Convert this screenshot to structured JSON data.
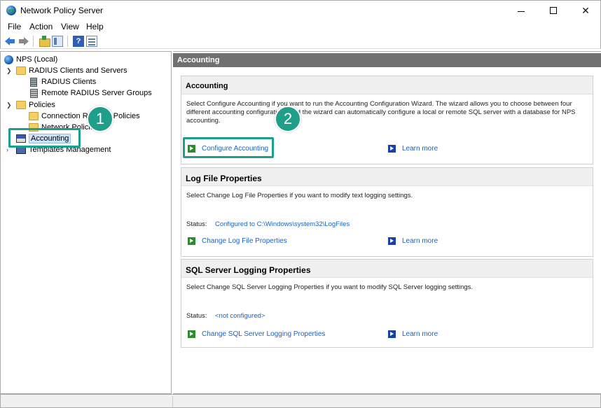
{
  "window": {
    "title": "Network Policy Server"
  },
  "menu": [
    "File",
    "Action",
    "View",
    "Help"
  ],
  "toolbar": {
    "help_glyph": "?"
  },
  "tree": {
    "root": "NPS (Local)",
    "radius_clients_and_servers": "RADIUS Clients and Servers",
    "radius_clients": "RADIUS Clients",
    "remote_groups": "Remote RADIUS Server Groups",
    "policies": "Policies",
    "connection_request_policies": "Connection Request Policies",
    "network_policies": "Network Policies",
    "accounting": "Accounting",
    "templates_management": "Templates Management"
  },
  "callouts": [
    "1",
    "2"
  ],
  "right": {
    "header": "Accounting",
    "accounting": {
      "title": "Accounting",
      "description": "Select Configure Accounting if you want to run the Accounting Configuration Wizard. The wizard allows you to choose between four different accounting configurations and the wizard can automatically configure a local or remote SQL server with a database for NPS accounting.",
      "action_link": "Configure Accounting",
      "learn_more": "Learn more"
    },
    "log_file": {
      "title": "Log File Properties",
      "description": "Select Change Log File Properties if you want to modify text logging settings.",
      "status_label": "Status:",
      "status_value": "Configured to C:\\Windows\\system32\\LogFiles",
      "action_link": "Change Log File Properties",
      "learn_more": "Learn more"
    },
    "sql": {
      "title": "SQL Server Logging Properties",
      "description": "Select Change SQL Server Logging Properties if you want to modify SQL Server logging settings.",
      "status_label": "Status:",
      "status_value": "<not configured>",
      "action_link": "Change SQL Server Logging Properties",
      "learn_more": "Learn more"
    }
  }
}
